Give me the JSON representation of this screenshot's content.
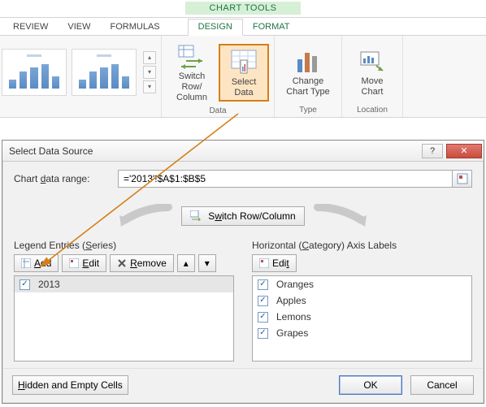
{
  "ribbon": {
    "contextual_title": "CHART TOOLS",
    "tabs": [
      "REVIEW",
      "VIEW",
      "FORMULAS"
    ],
    "chart_tabs": [
      "DESIGN",
      "FORMAT"
    ],
    "active_chart_tab": "DESIGN",
    "groups": {
      "data": {
        "caption": "Data",
        "switch_label_line1": "Switch Row/",
        "switch_label_line2": "Column",
        "select_label_line1": "Select",
        "select_label_line2": "Data"
      },
      "type": {
        "caption": "Type",
        "change_label_line1": "Change",
        "change_label_line2": "Chart Type"
      },
      "location": {
        "caption": "Location",
        "move_label_line1": "Move",
        "move_label_line2": "Chart"
      }
    }
  },
  "dialog": {
    "title": "Select Data Source",
    "range_label_prefix": "Chart ",
    "range_label_underlined": "d",
    "range_label_suffix": "ata range:",
    "range_value": "='2013'!$A$1:$B$5",
    "switch_btn_prefix": "S",
    "switch_btn_underlined": "w",
    "switch_btn_suffix": "itch Row/Column",
    "series_title": "Legend Entries (Series)",
    "axis_title": "Horizontal (Category) Axis Labels",
    "buttons": {
      "add": "Add",
      "edit": "Edit",
      "remove": "Remove",
      "edit2": "Edit",
      "hidden": "Hidden and Empty Cells",
      "ok": "OK",
      "cancel": "Cancel"
    },
    "series": [
      {
        "checked": true,
        "label": "2013"
      }
    ],
    "categories": [
      {
        "checked": true,
        "label": "Oranges"
      },
      {
        "checked": true,
        "label": "Apples"
      },
      {
        "checked": true,
        "label": "Lemons"
      },
      {
        "checked": true,
        "label": "Grapes"
      }
    ]
  }
}
